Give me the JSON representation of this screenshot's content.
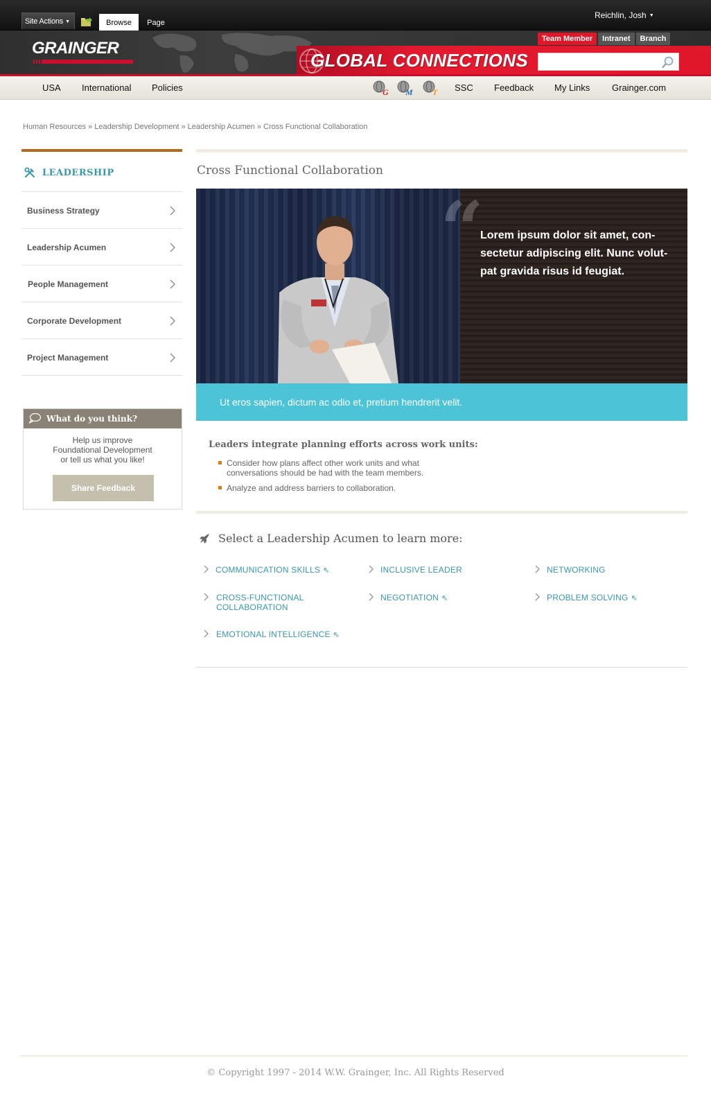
{
  "ribbon": {
    "site_actions": "Site Actions",
    "tab_browse": "Browse",
    "tab_page": "Page",
    "user": "Reichlin, Josh"
  },
  "header": {
    "logo": "GRAINGER",
    "banner_title": "GLOBAL CONNECTIONS",
    "audience_tabs": [
      "Team Member",
      "Intranet",
      "Branch"
    ],
    "search_placeholder": ""
  },
  "nav": {
    "left": [
      "USA",
      "International",
      "Policies"
    ],
    "icons": [
      "globe-g-icon",
      "globe-m-icon",
      "globe-t-icon"
    ],
    "right": [
      "SSC",
      "Feedback",
      "My Links",
      "Grainger.com"
    ]
  },
  "breadcrumb": [
    "Human Resources",
    "Leadership Development",
    "Leadership Acumen",
    "Cross Functional Collaboration"
  ],
  "sidebar": {
    "title": "LEADERSHIP",
    "items": [
      "Business Strategy",
      "Leadership Acumen",
      "People Management",
      "Corporate Development",
      "Project Management"
    ]
  },
  "feedback": {
    "title": "What do you think?",
    "line1": "Help us improve",
    "line2": "Foundational Development",
    "line3": "or tell us what you like!",
    "button": "Share Feedback"
  },
  "main": {
    "title": "Cross Functional Collaboration",
    "quote": "Lorem ipsum dolor sit amet, con-sectetur adipiscing elit. Nunc volut-pat gravida risus id feugiat.",
    "caption": "Ut eros sapien, dictum ac odio et, pretium hendrerit velit.",
    "points_title": "Leaders integrate planning efforts across work units:",
    "bullets": [
      "Consider how plans affect other work units and what conversations should be had with the team members.",
      "Analyze and address barriers to collaboration."
    ],
    "select_title": "Select a Leadership Acumen to learn more:",
    "acumens": [
      {
        "line1": "COMMUNICATION SKILLS",
        "line2": "",
        "external": true
      },
      {
        "line1": "INCLUSIVE LEADER",
        "line2": "",
        "external": false
      },
      {
        "line1": "NETWORKING",
        "line2": "",
        "external": false
      },
      {
        "line1": "CROSS-FUNCTIONAL",
        "line2": "COLLABORATION",
        "external": false
      },
      {
        "line1": "NEGOTIATION",
        "line2": "",
        "external": true
      },
      {
        "line1": "PROBLEM SOLVING",
        "line2": "",
        "external": true
      },
      {
        "line1": "EMOTIONAL INTELLIGENCE",
        "line2": "",
        "external": true
      }
    ]
  },
  "footer": {
    "copyright": "© Copyright 1997 - 2014 W.W. Grainger, Inc. All Rights Reserved"
  },
  "colors": {
    "accent_teal": "#3a97ab",
    "caption_blue": "#4cc3d6",
    "brand_red": "#e0162b",
    "sidebar_rule": "#b46a1e",
    "bullet_orange": "#e07a12"
  }
}
